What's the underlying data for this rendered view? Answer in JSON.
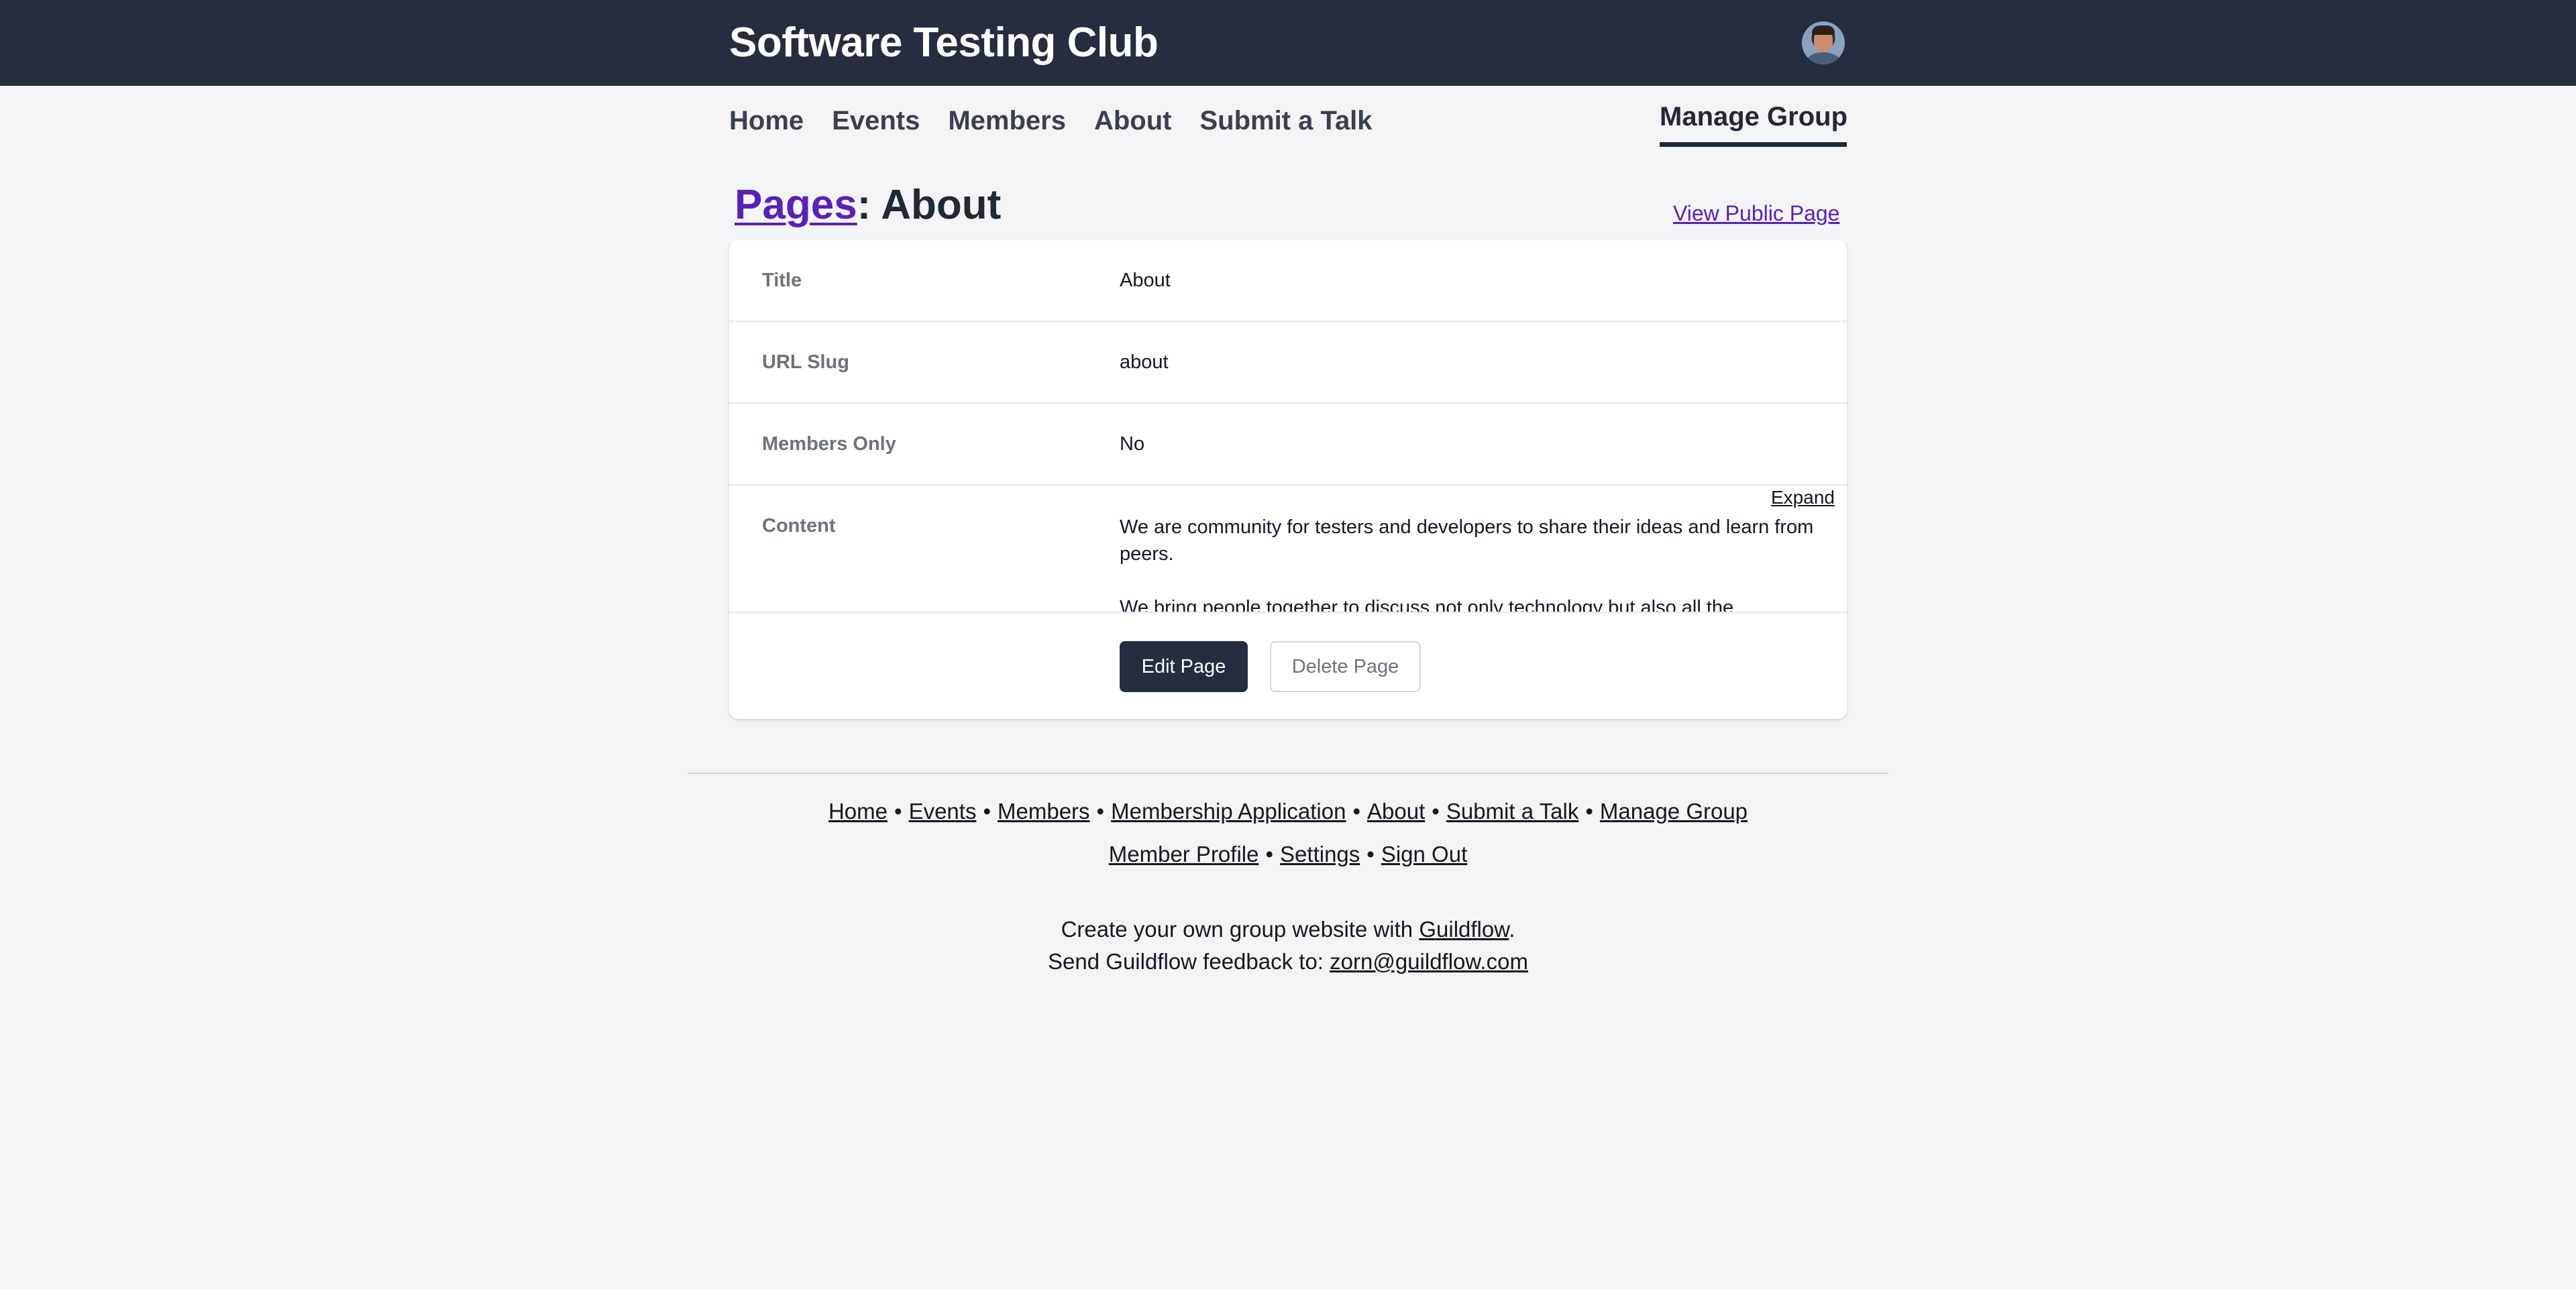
{
  "header": {
    "site_title": "Software Testing Club",
    "avatar_icon": "user-avatar"
  },
  "nav": {
    "items": [
      "Home",
      "Events",
      "Members",
      "About",
      "Submit a Talk"
    ],
    "manage_group": "Manage Group"
  },
  "page": {
    "breadcrumb_link": "Pages",
    "breadcrumb_rest": ": About",
    "view_public": "View Public Page"
  },
  "details": {
    "rows": [
      {
        "label": "Title",
        "value": "About"
      },
      {
        "label": "URL Slug",
        "value": "about"
      },
      {
        "label": "Members Only",
        "value": "No"
      }
    ],
    "content_label": "Content",
    "content_paragraphs": [
      "We are community for testers and developers to share their ideas and learn from peers.",
      "We bring people together to discuss not only technology but also all the"
    ],
    "expand": "Expand",
    "edit_button": "Edit Page",
    "delete_button": "Delete Page"
  },
  "footer": {
    "links_row1": [
      "Home",
      "Events",
      "Members",
      "Membership Application",
      "About",
      "Submit a Talk",
      "Manage Group"
    ],
    "links_row2": [
      "Member Profile",
      "Settings",
      "Sign Out"
    ],
    "separator": "•",
    "create_text": "Create your own group website with ",
    "create_link": "Guildflow",
    "create_end": ".",
    "feedback_text": "Send Guildflow feedback to: ",
    "feedback_email": "zorn@guildflow.com"
  },
  "colors": {
    "topbar": "#252d3e",
    "link_purple": "#5b21b6",
    "background": "#f3f4f6"
  }
}
